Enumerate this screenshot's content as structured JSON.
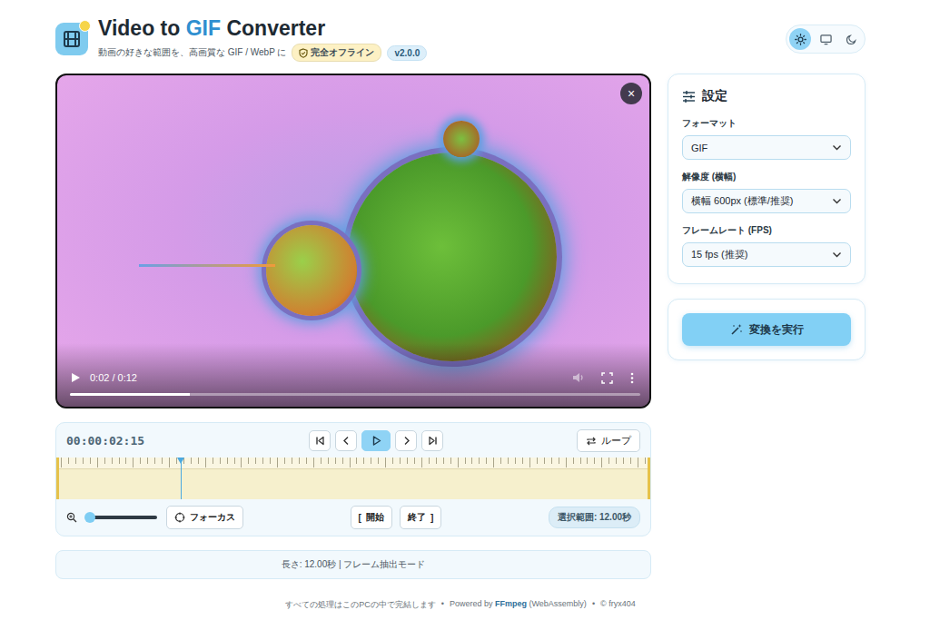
{
  "header": {
    "title": [
      {
        "text": "Video to ",
        "highlight": false
      },
      {
        "text": "GIF",
        "highlight": true
      },
      {
        "text": " Converter",
        "highlight": false
      }
    ],
    "subtitle": "動画の好きな範囲を、高画質な GIF / WebP に",
    "badges": [
      {
        "label": "完全オフライン",
        "color": "#fdf1c4"
      },
      {
        "label": "v2.0.0",
        "color": "#ddeffa"
      }
    ],
    "theme": [
      {
        "kind": "light",
        "selected": true
      },
      {
        "kind": "system",
        "selected": false
      },
      {
        "kind": "dark",
        "selected": false
      }
    ]
  },
  "video": {
    "close": "×",
    "time": "0:02 / 0:12",
    "level": 0.21,
    "playing": false
  },
  "timeline": {
    "timecode": "00:00:02:15",
    "transport": [
      {
        "kind": "first",
        "selected": false
      },
      {
        "kind": "prev",
        "selected": false
      },
      {
        "kind": "play",
        "selected": true
      },
      {
        "kind": "next",
        "selected": false
      },
      {
        "kind": "last",
        "selected": false
      }
    ],
    "loop": {
      "label": "ループ",
      "on": false
    },
    "playhead": 0.207,
    "zoom": {
      "level": 0
    },
    "focus": "フォーカス",
    "start": {
      "bracket": "[",
      "label": "開始"
    },
    "end": {
      "bracket": "]",
      "label": "終了"
    },
    "selection": "選択範囲: 12.00秒"
  },
  "info": "長さ: 12.00秒 | フレーム抽出モード",
  "settings": {
    "title": "設定",
    "fields": [
      {
        "label": "フォーマット",
        "value": "GIF"
      },
      {
        "label": "解像度 (横幅)",
        "value": "横幅 600px (標準/推奨)"
      },
      {
        "label": "フレームレート (FPS)",
        "value": "15 fps (推奨)"
      }
    ],
    "convert": "変換を実行"
  },
  "footer": {
    "text": "すべての処理はこのPCの中で完結します",
    "separator": "•",
    "powered_prefix": "Powered by",
    "powered_name": "FFmpeg",
    "powered_suffix": "(WebAssembly)",
    "copyright": "© fryx404"
  }
}
